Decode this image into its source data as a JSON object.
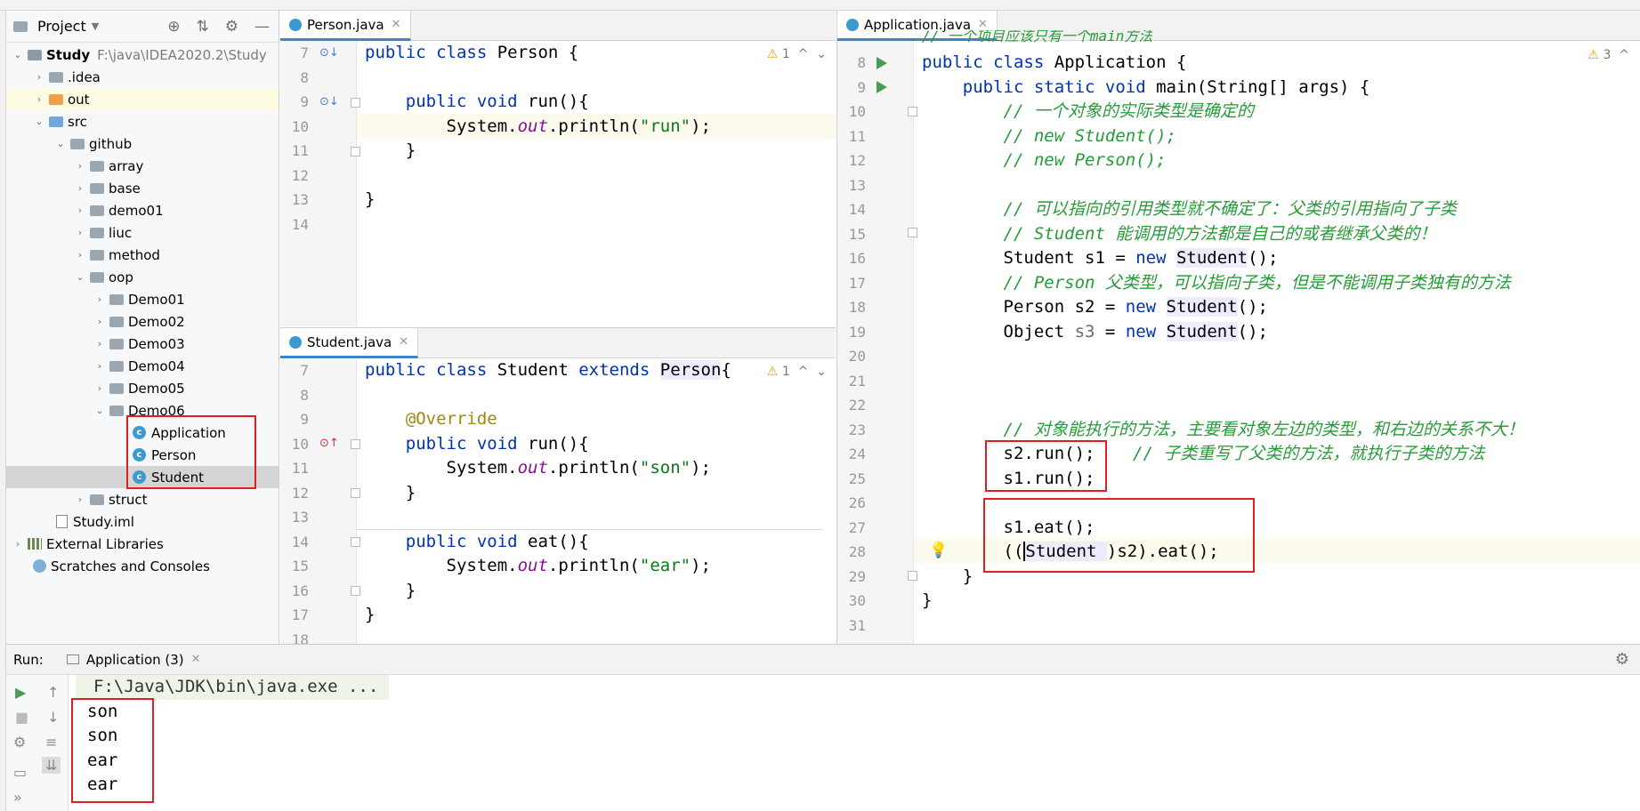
{
  "project_panel": {
    "title": "Project",
    "tree": [
      {
        "label": "Study",
        "note": "F:\\java\\IDEA2020.2\\Study"
      },
      {
        "label": ".idea"
      },
      {
        "label": "out"
      },
      {
        "label": "src"
      },
      {
        "label": "github"
      },
      {
        "label": "array"
      },
      {
        "label": "base"
      },
      {
        "label": "demo01"
      },
      {
        "label": "liuc"
      },
      {
        "label": "method"
      },
      {
        "label": "oop"
      },
      {
        "label": "Demo01"
      },
      {
        "label": "Demo02"
      },
      {
        "label": "Demo03"
      },
      {
        "label": "Demo04"
      },
      {
        "label": "Demo05"
      },
      {
        "label": "Demo06"
      },
      {
        "label": "Application"
      },
      {
        "label": "Person"
      },
      {
        "label": "Student"
      },
      {
        "label": "struct"
      },
      {
        "label": "Study.iml"
      },
      {
        "label": "External Libraries"
      },
      {
        "label": "Scratches and Consoles"
      }
    ]
  },
  "editors": {
    "person": {
      "tab": "Person.java",
      "warnings": "1",
      "lines": [
        {
          "n": "7",
          "t": "public class Person {"
        },
        {
          "n": "8",
          "t": ""
        },
        {
          "n": "9",
          "t": "    public void run(){"
        },
        {
          "n": "10",
          "t": "        System.out.println(\"run\");"
        },
        {
          "n": "11",
          "t": "    }"
        },
        {
          "n": "12",
          "t": ""
        },
        {
          "n": "13",
          "t": "}"
        },
        {
          "n": "14",
          "t": ""
        }
      ]
    },
    "student": {
      "tab": "Student.java",
      "warnings": "1",
      "lines": [
        {
          "n": "7",
          "t": "public class Student extends Person{"
        },
        {
          "n": "8",
          "t": ""
        },
        {
          "n": "9",
          "t": "    @Override"
        },
        {
          "n": "10",
          "t": "    public void run(){"
        },
        {
          "n": "11",
          "t": "        System.out.println(\"son\");"
        },
        {
          "n": "12",
          "t": "    }"
        },
        {
          "n": "13",
          "t": ""
        },
        {
          "n": "14",
          "t": "    public void eat(){"
        },
        {
          "n": "15",
          "t": "        System.out.println(\"ear\");"
        },
        {
          "n": "16",
          "t": "    }"
        },
        {
          "n": "17",
          "t": "}"
        },
        {
          "n": "18",
          "t": ""
        }
      ]
    },
    "application": {
      "tab": "Application.java",
      "warnings": "3",
      "top_partial": "// 一个项目应该只有一个main方法",
      "lines": [
        {
          "n": "8",
          "t": "public class Application {"
        },
        {
          "n": "9",
          "t": "    public static void main(String[] args) {"
        },
        {
          "n": "10",
          "t": "        // 一个对象的实际类型是确定的"
        },
        {
          "n": "11",
          "t": "        // new Student();"
        },
        {
          "n": "12",
          "t": "        // new Person();"
        },
        {
          "n": "13",
          "t": ""
        },
        {
          "n": "14",
          "t": "        // 可以指向的引用类型就不确定了：父类的引用指向了子类"
        },
        {
          "n": "15",
          "t": "        // Student 能调用的方法都是自己的或者继承父类的！"
        },
        {
          "n": "16",
          "t": "        Student s1 = new Student();"
        },
        {
          "n": "17",
          "t": "        // Person 父类型，可以指向子类，但是不能调用子类独有的方法"
        },
        {
          "n": "18",
          "t": "        Person s2 = new Student();"
        },
        {
          "n": "19",
          "t": "        Object s3 = new Student();"
        },
        {
          "n": "20",
          "t": ""
        },
        {
          "n": "21",
          "t": ""
        },
        {
          "n": "22",
          "t": ""
        },
        {
          "n": "23",
          "t": "        // 对象能执行的方法，主要看对象左边的类型，和右边的关系不大！"
        },
        {
          "n": "24",
          "t": "        s2.run();"
        },
        {
          "n": "24c",
          "t": "// 子类重写了父类的方法，就执行子类的方法"
        },
        {
          "n": "25",
          "t": "        s1.run();"
        },
        {
          "n": "26",
          "t": ""
        },
        {
          "n": "27",
          "t": "        s1.eat();"
        },
        {
          "n": "28",
          "t": "        ((Student )s2).eat();"
        },
        {
          "n": "29",
          "t": "    }"
        },
        {
          "n": "30",
          "t": "}"
        },
        {
          "n": "31",
          "t": ""
        }
      ]
    }
  },
  "run_panel": {
    "label": "Run:",
    "tab": "Application (3)",
    "command": "F:\\Java\\JDK\\bin\\java.exe ...",
    "output": [
      "son",
      "son",
      "ear",
      "ear"
    ]
  },
  "colors": {
    "keyword": "#0033b3",
    "string": "#067d17",
    "comment": "#8c8c8c",
    "annotation": "#9e880d",
    "accent": "#4083c9",
    "highlight_box": "#e02020"
  }
}
